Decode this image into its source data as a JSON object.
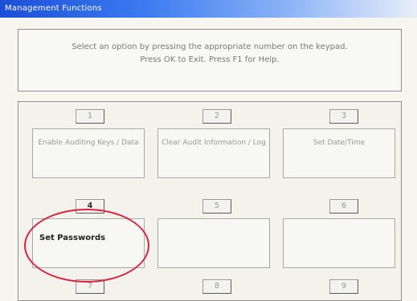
{
  "window": {
    "title": "Management Functions"
  },
  "instructions": {
    "line1": "Select an option by pressing the appropriate number on the keypad.",
    "line2": "Press OK to Exit. Press F1 for Help."
  },
  "options": [
    {
      "key": "1",
      "label": "Enable Auditing Keys / Data"
    },
    {
      "key": "2",
      "label": "Clear Audit Information / Log"
    },
    {
      "key": "3",
      "label": "Set Date/Time"
    },
    {
      "key": "4",
      "label": "Set Passwords"
    },
    {
      "key": "5",
      "label": ""
    },
    {
      "key": "6",
      "label": ""
    },
    {
      "key": "7",
      "label": ""
    },
    {
      "key": "8",
      "label": ""
    },
    {
      "key": "9",
      "label": ""
    }
  ],
  "highlight_color": "#d9243c"
}
